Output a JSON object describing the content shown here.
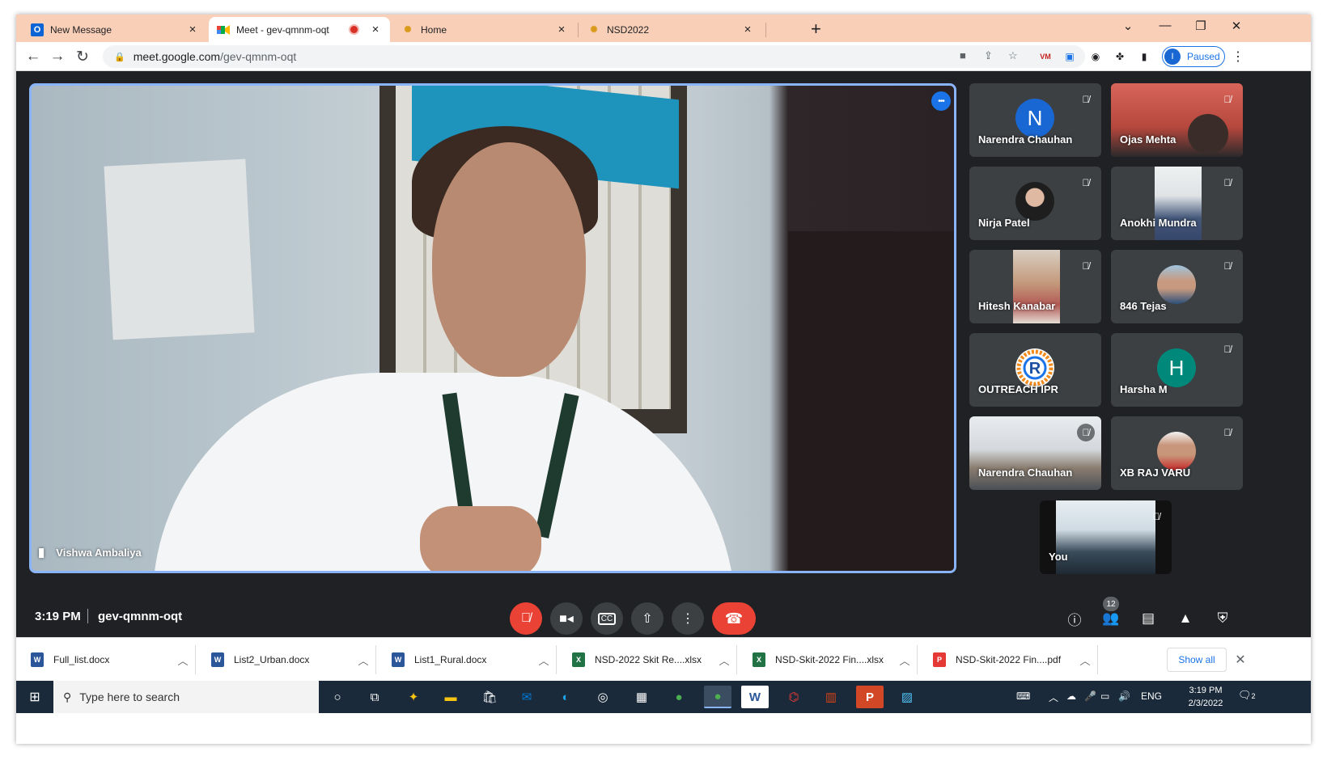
{
  "browser": {
    "tabs": [
      {
        "title": "New Message",
        "favicon": "outlook-icon",
        "active": false
      },
      {
        "title": "Meet - gev-qmnm-oqt",
        "favicon": "google-meet-icon",
        "active": true,
        "recording": true
      },
      {
        "title": "Home",
        "favicon": "nsd-logo-icon",
        "active": false
      },
      {
        "title": "NSD2022",
        "favicon": "nsd-logo-icon",
        "active": false
      }
    ],
    "url_host": "meet.google.com",
    "url_path": "/gev-qmnm-oqt",
    "profile_initial": "I",
    "profile_status": "Paused"
  },
  "meet": {
    "main_speaker": "Vishwa Ambaliya",
    "participants": [
      {
        "name": "Narendra Chauhan",
        "avatar": "N",
        "avatar_color": "#1967d2",
        "muted": true
      },
      {
        "name": "Ojas Mehta",
        "avatar": "photo",
        "muted": true
      },
      {
        "name": "Nirja Patel",
        "avatar": "photo",
        "muted": true
      },
      {
        "name": "Anokhi Mundra",
        "avatar": "photo",
        "muted": true
      },
      {
        "name": "Hitesh Kanabar",
        "avatar": "photo",
        "muted": true
      },
      {
        "name": "846 Tejas",
        "avatar": "photo",
        "muted": true
      },
      {
        "name": "OUTREACH IPR",
        "avatar": "logo",
        "muted": false
      },
      {
        "name": "Harsha M",
        "avatar": "H",
        "avatar_color": "#00897b",
        "muted": true
      },
      {
        "name": "Narendra Chauhan",
        "avatar": "photo",
        "muted": true
      },
      {
        "name": "XB RAJ VARU",
        "avatar": "photo",
        "muted": true
      }
    ],
    "self_tile": "You",
    "time": "3:19 PM",
    "code": "gev-qmnm-oqt",
    "people_count": "12"
  },
  "downloads": [
    {
      "name": "Full_list.docx",
      "type": "word"
    },
    {
      "name": "List2_Urban.docx",
      "type": "word"
    },
    {
      "name": "List1_Rural.docx",
      "type": "word"
    },
    {
      "name": "NSD-2022 Skit Re....xlsx",
      "type": "excel"
    },
    {
      "name": "NSD-Skit-2022 Fin....xlsx",
      "type": "excel"
    },
    {
      "name": "NSD-Skit-2022 Fin....pdf",
      "type": "pdf"
    }
  ],
  "downloads_show_all": "Show all",
  "taskbar": {
    "search_placeholder": "Type here to search",
    "language": "ENG",
    "time": "3:19 PM",
    "date": "2/3/2022",
    "notification_count": "2"
  },
  "colors": {
    "tabstrip": "#f9cfb7",
    "meet_bg": "#202124",
    "accent_blue": "#8ab4f8",
    "end_call_red": "#ea4335"
  }
}
